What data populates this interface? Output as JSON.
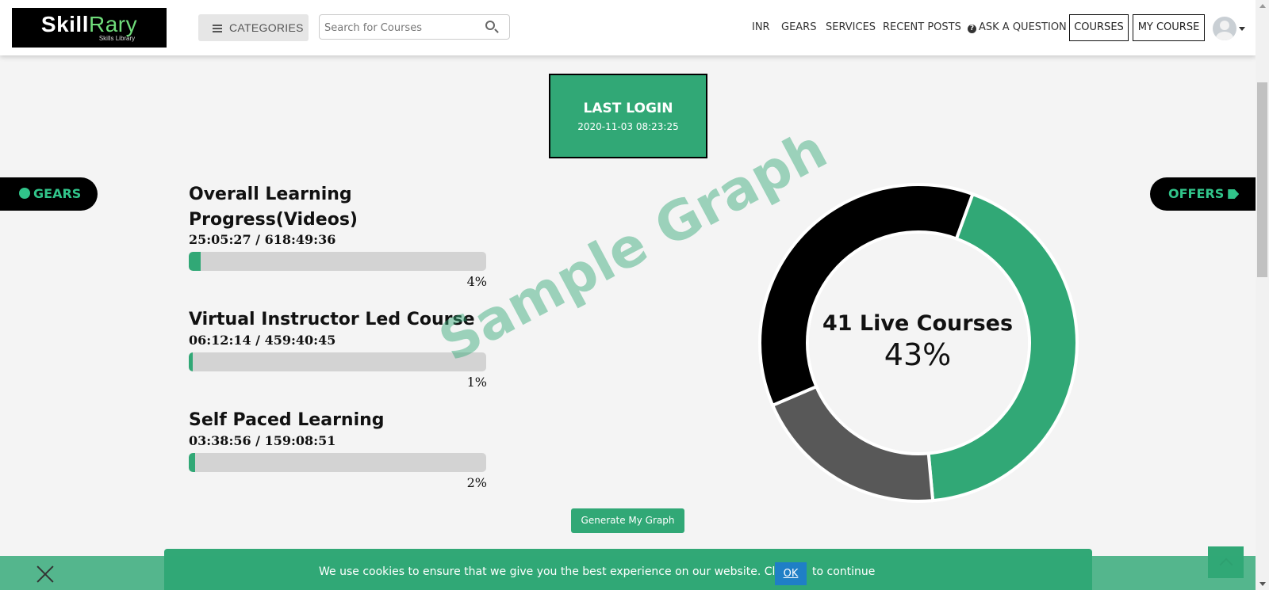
{
  "header": {
    "logo": {
      "brand_part1": "Skill",
      "brand_part2": "Rary",
      "tagline": "Skills Library"
    },
    "categories_label": "CATEGORIES",
    "search_placeholder": "Search for Courses",
    "nav": [
      "INR",
      "GEARS",
      "SERVICES",
      "RECENT POSTS",
      "ASK A QUESTION"
    ],
    "courses_label": "COURSES",
    "my_course_label": "MY COURSE"
  },
  "last_login": {
    "title": "LAST LOGIN",
    "datetime": "2020-11-03 08:23:25"
  },
  "side_tabs": {
    "gears": "GEARS",
    "offers": "OFFERS"
  },
  "progress": [
    {
      "title": "Overall Learning Progress(Videos)",
      "time": "25:05:27 / 618:49:36",
      "percent_label": "4%",
      "percent": 4
    },
    {
      "title": "Virtual Instructor Led Course",
      "time": "06:12:14 / 459:40:45",
      "percent_label": "1%",
      "percent": 1
    },
    {
      "title": "Self Paced Learning",
      "time": "03:38:56 / 159:08:51",
      "percent_label": "2%",
      "percent": 2
    }
  ],
  "watermark": "Sample Graph",
  "chart_data": {
    "type": "pie",
    "segments": [
      {
        "value": 43,
        "color": "#31a876"
      },
      {
        "value": 20,
        "color": "#585858"
      },
      {
        "value": 37,
        "color": "#000000"
      }
    ],
    "center_label": "41 Live Courses",
    "center_value": "43%"
  },
  "generate_button": "Generate My Graph",
  "cookie": {
    "text_before": "We use cookies to ensure that we give you the best experience on our website. Click",
    "ok_label": "OK",
    "text_after": "to continue"
  },
  "colors": {
    "accent": "#31a876",
    "dark": "#000000",
    "grey": "#585858",
    "ok_blue": "#1f7fc6"
  }
}
